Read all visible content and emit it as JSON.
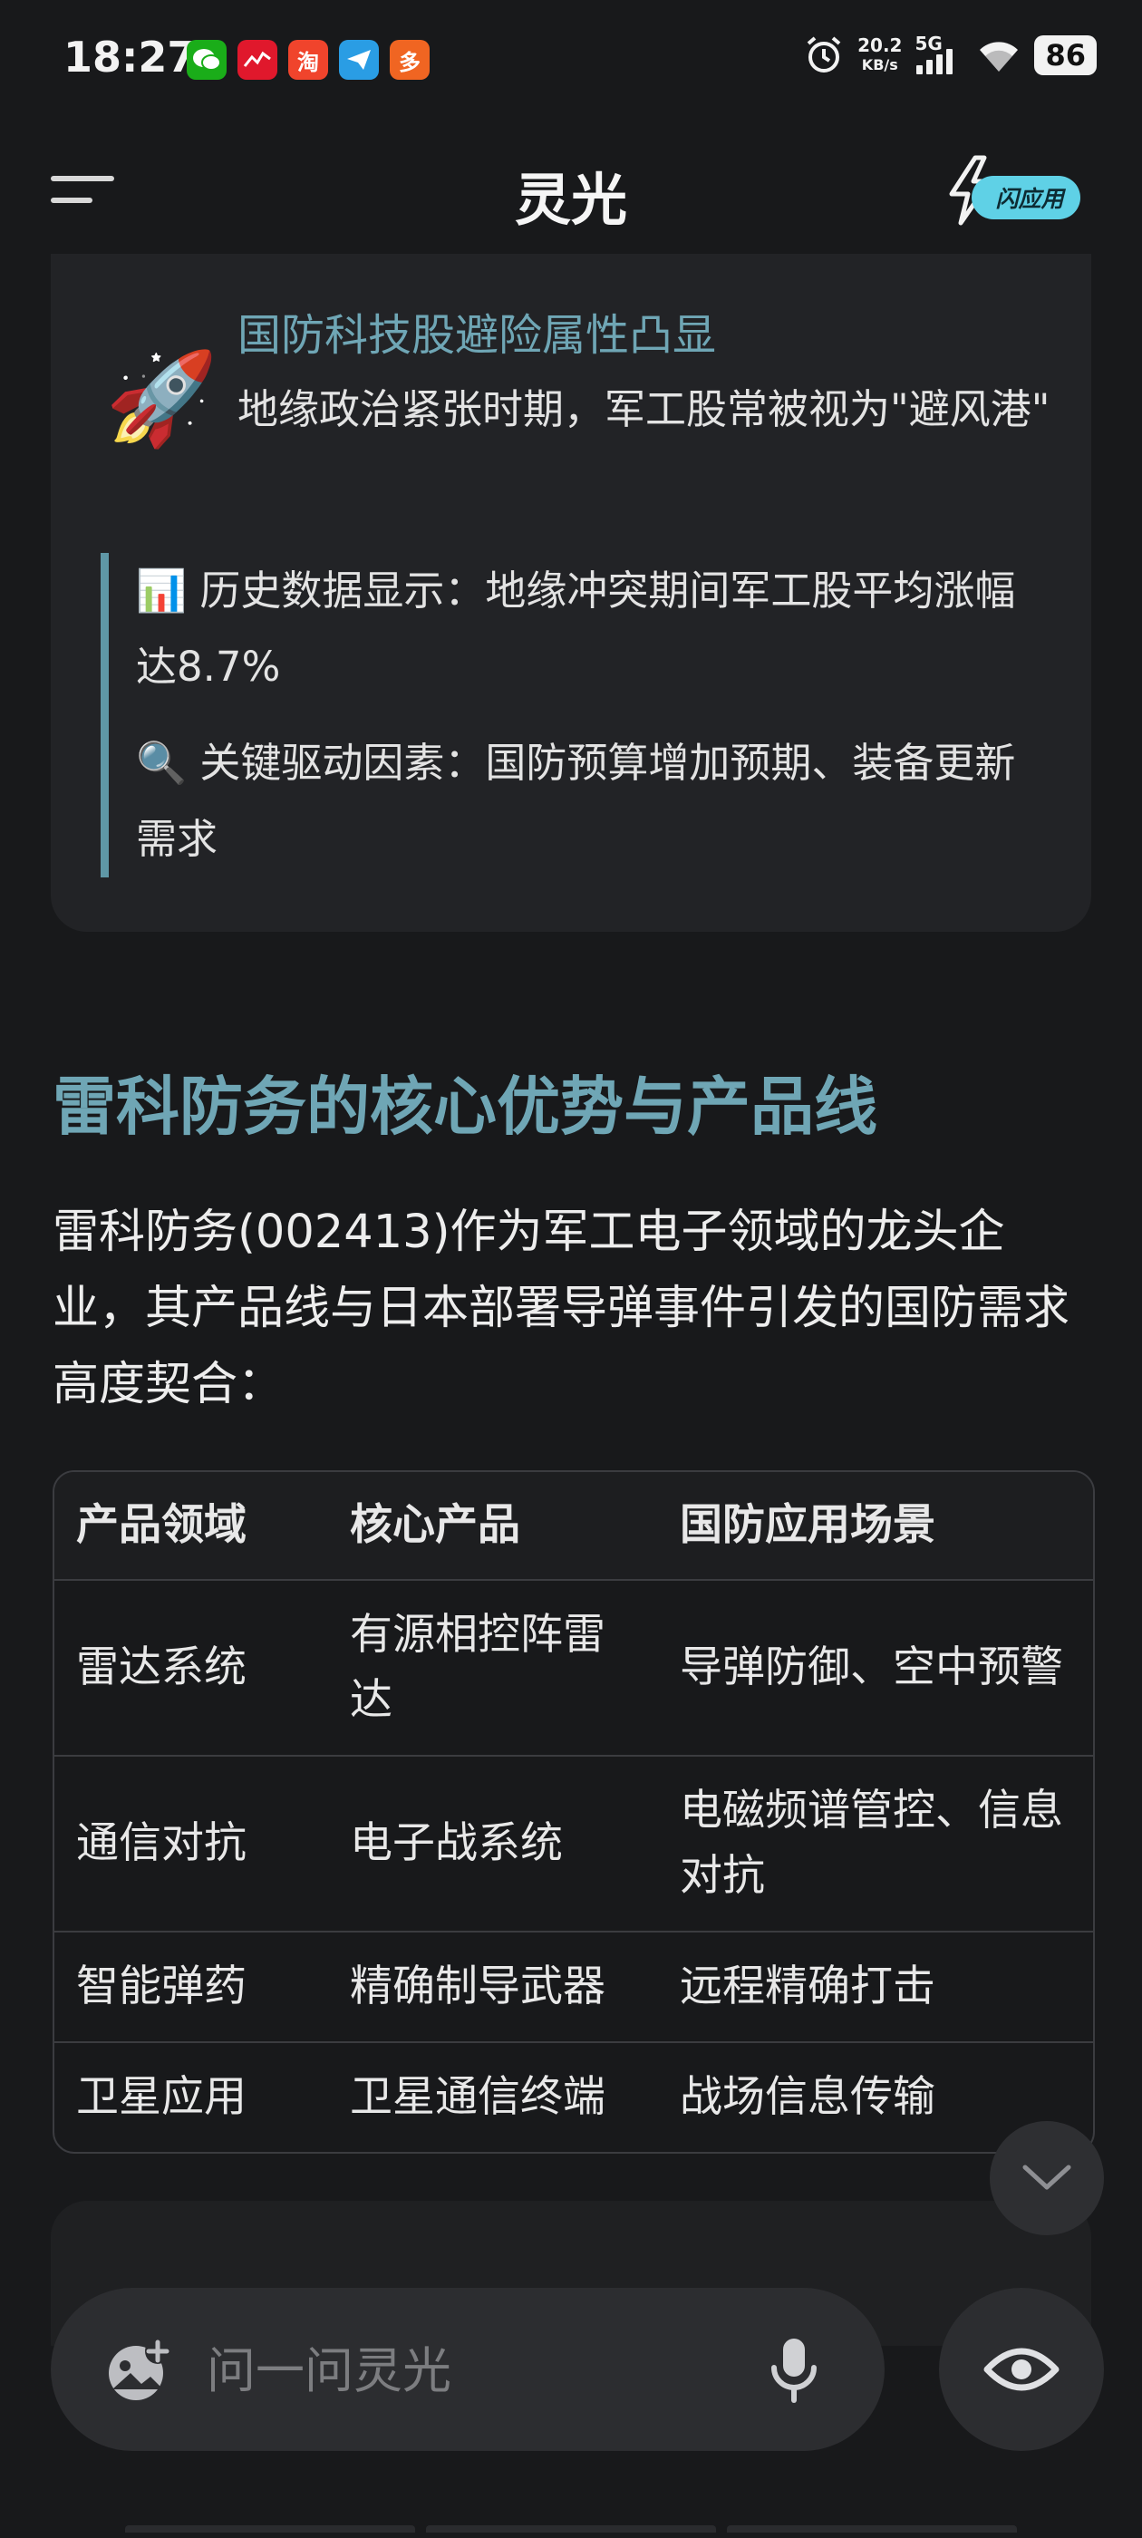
{
  "status_bar": {
    "time": "18:27",
    "network_speed": "20.2",
    "network_unit": "KB/s",
    "signal_type": "5G",
    "battery": "86"
  },
  "header": {
    "title": "灵光",
    "flash_app_label": "闪应用"
  },
  "card": {
    "icon": "rocket-icon",
    "heading": "国防科技股避险属性凸显",
    "description": "地缘政治紧张时期，军工股常被视为\"避风港\"",
    "quote_lines": [
      "📊 历史数据显示：地缘冲突期间军工股平均涨幅达8.7%",
      "🔍 关键驱动因素：国防预算增加预期、装备更新需求"
    ]
  },
  "section": {
    "title": "雷科防务的核心优势与产品线",
    "body": "雷科防务(002413)作为军工电子领域的龙头企业，其产品线与日本部署导弹事件引发的国防需求高度契合："
  },
  "table": {
    "headers": [
      "产品领域",
      "核心产品",
      "国防应用场景"
    ],
    "rows": [
      [
        "雷达系统",
        "有源相控阵雷达",
        "导弹防御、空中预警"
      ],
      [
        "通信对抗",
        "电子战系统",
        "电磁频谱管控、信息对抗"
      ],
      [
        "智能弹药",
        "精确制导武器",
        "远程精确打击"
      ],
      [
        "卫星应用",
        "卫星通信终端",
        "战场信息传输"
      ]
    ]
  },
  "input_bar": {
    "placeholder": "问一问灵光",
    "value": ""
  },
  "colors": {
    "background": "#18191b",
    "card": "#222326",
    "accent": "#6fa6b5",
    "flash_pill": "#5fd1e6"
  }
}
